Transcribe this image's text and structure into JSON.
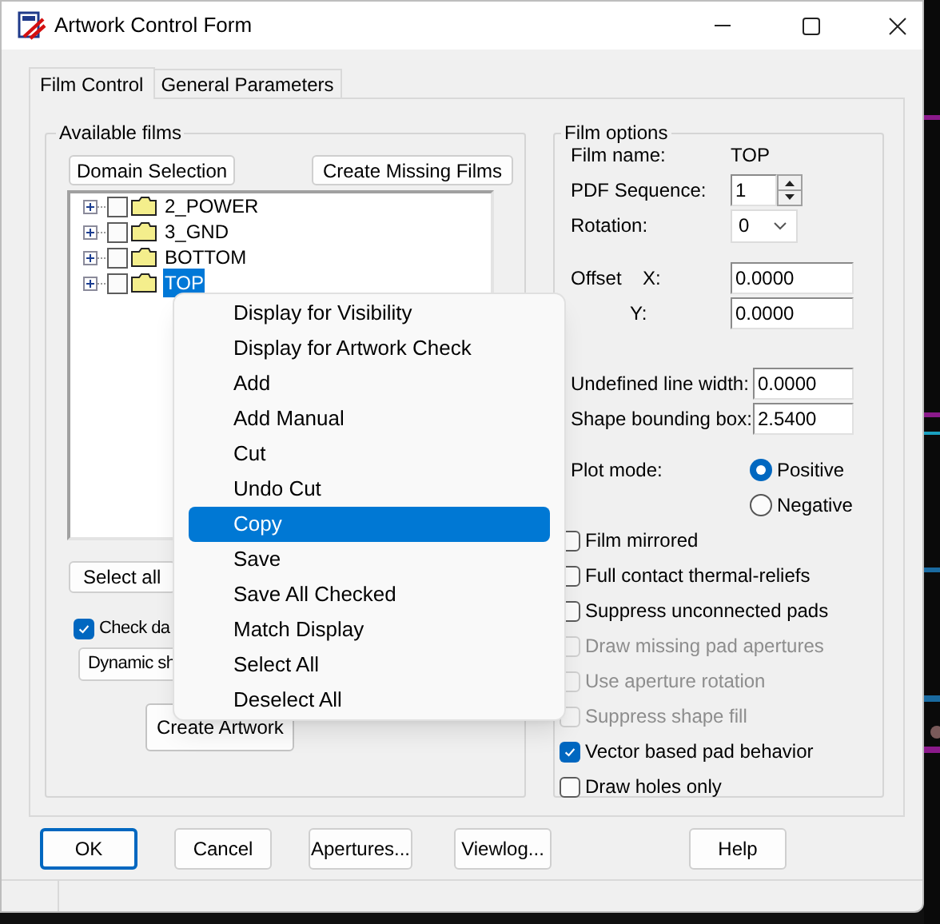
{
  "window": {
    "title": "Artwork Control Form"
  },
  "tabs": [
    {
      "label": "Film Control",
      "selected": true
    },
    {
      "label": "General Parameters",
      "selected": false
    }
  ],
  "available_films": {
    "title": "Available films",
    "domain_button": "Domain Selection",
    "create_missing_button": "Create Missing Films",
    "tree": [
      {
        "label": "2_POWER",
        "checked": false,
        "selected": false
      },
      {
        "label": "3_GND",
        "checked": false,
        "selected": false
      },
      {
        "label": "BOTTOM",
        "checked": false,
        "selected": false
      },
      {
        "label": "TOP",
        "checked": false,
        "selected": true
      }
    ],
    "select_all_button": "Select all",
    "check_option": {
      "label": "Check da",
      "checked": true
    },
    "dynamic_button": "Dynamic sh",
    "create_artwork_button": "Create Artwork"
  },
  "context_menu": [
    {
      "label": "Display for Visibility",
      "selected": false
    },
    {
      "label": "Display for Artwork Check",
      "selected": false
    },
    {
      "label": "Add",
      "selected": false
    },
    {
      "label": "Add Manual",
      "selected": false
    },
    {
      "label": "Cut",
      "selected": false
    },
    {
      "label": "Undo Cut",
      "selected": false
    },
    {
      "label": "Copy",
      "selected": true
    },
    {
      "label": "Save",
      "selected": false
    },
    {
      "label": "Save All Checked",
      "selected": false
    },
    {
      "label": "Match Display",
      "selected": false
    },
    {
      "label": "Select All",
      "selected": false
    },
    {
      "label": "Deselect All",
      "selected": false
    }
  ],
  "film_options": {
    "title": "Film options",
    "film_name_label": "Film name:",
    "film_name": "TOP",
    "pdf_sequence": {
      "label": "PDF Sequence:",
      "value": "1"
    },
    "rotation": {
      "label": "Rotation:",
      "value": "0"
    },
    "offset_label": "Offset",
    "offset_x": {
      "label": "X:",
      "value": "0.0000"
    },
    "offset_y": {
      "label": "Y:",
      "value": "0.0000"
    },
    "undefined_line_width": {
      "label": "Undefined line width:",
      "value": "0.0000"
    },
    "shape_bounding_box": {
      "label": "Shape bounding box:",
      "value": "2.5400"
    },
    "plot_mode": {
      "label": "Plot mode:",
      "options": [
        {
          "label": "Positive",
          "selected": true
        },
        {
          "label": "Negative",
          "selected": false
        }
      ]
    },
    "options": [
      {
        "label": "Film mirrored",
        "checked": false,
        "disabled": false
      },
      {
        "label": "Full contact thermal-reliefs",
        "checked": false,
        "disabled": false
      },
      {
        "label": "Suppress unconnected pads",
        "checked": false,
        "disabled": false
      },
      {
        "label": "Draw missing pad apertures",
        "checked": false,
        "disabled": true
      },
      {
        "label": "Use aperture rotation",
        "checked": false,
        "disabled": true
      },
      {
        "label": "Suppress shape fill",
        "checked": false,
        "disabled": true
      },
      {
        "label": "Vector based pad behavior",
        "checked": true,
        "disabled": false
      },
      {
        "label": "Draw holes only",
        "checked": false,
        "disabled": false
      }
    ]
  },
  "buttons": [
    {
      "label": "OK",
      "focused": true
    },
    {
      "label": "Cancel",
      "focused": false
    },
    {
      "label": "Apertures...",
      "focused": false
    },
    {
      "label": "Viewlog...",
      "focused": false
    },
    {
      "label": "Help",
      "focused": false
    }
  ]
}
